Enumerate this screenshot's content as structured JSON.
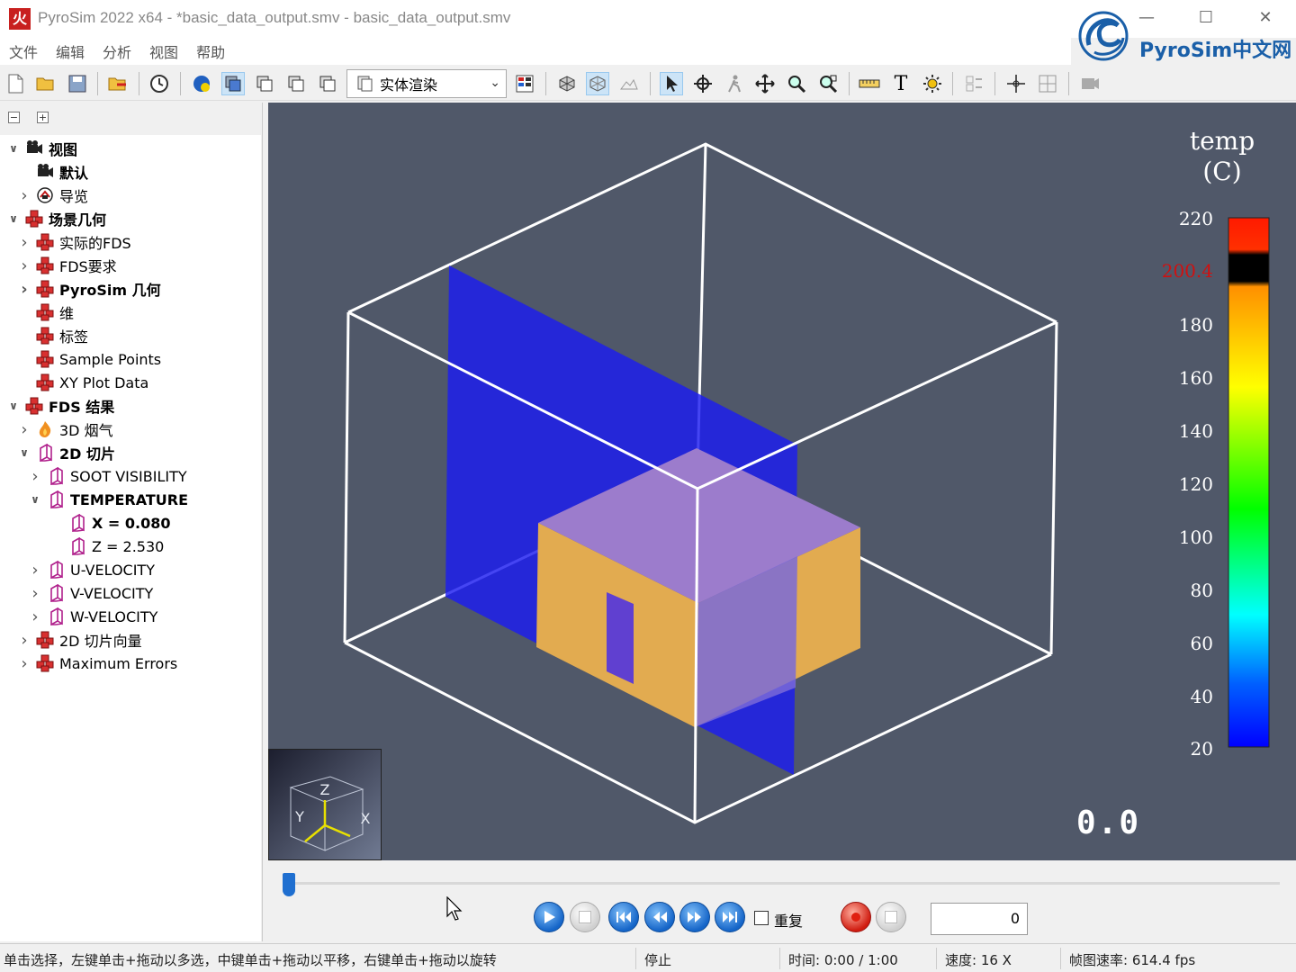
{
  "window": {
    "app_icon_glyph": "火",
    "title": "PyroSim 2022 x64 - *basic_data_output.smv - basic_data_output.smv",
    "minimize_glyph": "—",
    "maximize_glyph": "☐",
    "close_glyph": "✕",
    "brand_text": "PyroSim中文网"
  },
  "menu": [
    "文件",
    "编辑",
    "分析",
    "视图",
    "帮助"
  ],
  "toolbar": {
    "render_mode": "实体渲染",
    "text_tool_glyph": "T"
  },
  "tree_header": {
    "collapse": "−",
    "expand": "+"
  },
  "tree": [
    {
      "label": "视图",
      "bold": true,
      "expanded": true,
      "icon": "camera-icon"
    },
    {
      "label": "默认",
      "bold": true,
      "icon": "camera-icon"
    },
    {
      "label": "导览",
      "expandable": true,
      "icon": "tour-icon"
    },
    {
      "label": "场景几何",
      "bold": true,
      "expanded": true,
      "icon": "geometry-icon"
    },
    {
      "label": "实际的FDS",
      "expandable": true,
      "icon": "geometry-icon"
    },
    {
      "label": "FDS要求",
      "expandable": true,
      "icon": "geometry-icon"
    },
    {
      "label": "PyroSim 几何",
      "bold": true,
      "expandable": true,
      "icon": "geometry-icon"
    },
    {
      "label": "维",
      "icon": "geometry-icon"
    },
    {
      "label": "标签",
      "icon": "geometry-icon"
    },
    {
      "label": "Sample Points",
      "icon": "geometry-icon"
    },
    {
      "label": "XY Plot Data",
      "icon": "geometry-icon"
    },
    {
      "label": "FDS 结果",
      "bold": true,
      "expanded": true,
      "icon": "geometry-icon"
    },
    {
      "label": "3D 烟气",
      "expandable": true,
      "icon": "fire-icon"
    },
    {
      "label": "2D 切片",
      "bold": true,
      "expanded": true,
      "icon": "slice-icon"
    },
    {
      "label": "SOOT VISIBILITY",
      "expandable": true,
      "icon": "slice-icon"
    },
    {
      "label": "TEMPERATURE",
      "bold": true,
      "expanded": true,
      "icon": "slice-icon"
    },
    {
      "label": "X = 0.080",
      "bold": true,
      "icon": "slice-icon"
    },
    {
      "label": "Z = 2.530",
      "icon": "slice-icon"
    },
    {
      "label": "U-VELOCITY",
      "expandable": true,
      "icon": "slice-icon"
    },
    {
      "label": "V-VELOCITY",
      "expandable": true,
      "icon": "slice-icon"
    },
    {
      "label": "W-VELOCITY",
      "expandable": true,
      "icon": "slice-icon"
    },
    {
      "label": "2D 切片向量",
      "expandable": true,
      "icon": "geometry-icon"
    },
    {
      "label": "Maximum Errors",
      "expandable": true,
      "icon": "geometry-icon"
    }
  ],
  "viewport": {
    "background": "#505869",
    "legend_title_line1": "temp",
    "legend_title_line2": "(C)",
    "legend_ticks": [
      "220",
      "200.4",
      "180",
      "160",
      "140",
      "120",
      "100",
      "80",
      "60",
      "40",
      "20"
    ],
    "legend_marker_value": "200.4",
    "legend_colors": [
      "#ff0000",
      "#000000",
      "#ff9a00",
      "#ffff00",
      "#00ff00",
      "#00ffff",
      "#0000ff"
    ],
    "time_readout": "0.0",
    "axis_labels": {
      "z": "Z",
      "y": "Y",
      "x": "X"
    },
    "slice_color": "#1c1cf0",
    "building_color": "#e2ab50"
  },
  "playback": {
    "progress": 0.0,
    "repeat_label": "重复",
    "repeat_checked": false,
    "frame_value": "0"
  },
  "status": {
    "hint": "单击选择，左键单击+拖动以多选，中键单击+拖动以平移，右键单击+拖动以旋转",
    "state": "停止",
    "time": "时间:  0:00 / 1:00",
    "speed": "速度:  16 X",
    "fps": "帧图速率:  614.4 fps"
  }
}
